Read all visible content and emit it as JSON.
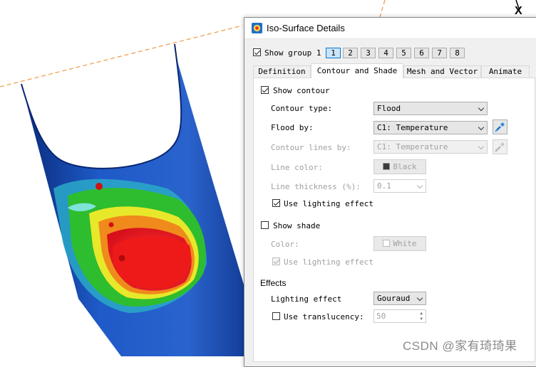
{
  "dialog": {
    "title": "Iso-Surface Details",
    "show_group_label": "Show group 1",
    "group_buttons": [
      "1",
      "2",
      "3",
      "4",
      "5",
      "6",
      "7",
      "8"
    ],
    "active_group": "1",
    "tabs": [
      "Definition",
      "Contour and Shade",
      "Mesh and Vector",
      "Animate"
    ],
    "active_tab": "Contour and Shade",
    "contour": {
      "show_contour_label": "Show contour",
      "show_contour_checked": true,
      "contour_type_label": "Contour type:",
      "contour_type_value": "Flood",
      "flood_by_label": "Flood by:",
      "flood_by_value": "C1: Temperature",
      "contour_lines_by_label": "Contour lines by:",
      "contour_lines_by_value": "C1: Temperature",
      "line_color_label": "Line color:",
      "line_color_value": "Black",
      "line_color_hex": "#3c3c3c",
      "line_thickness_label": "Line thickness (%):",
      "line_thickness_value": "0.1",
      "use_lighting_label": "Use lighting effect",
      "use_lighting_checked": true
    },
    "shade": {
      "show_shade_label": "Show shade",
      "show_shade_checked": false,
      "color_label": "Color:",
      "color_value": "White",
      "color_hex": "#ffffff",
      "use_lighting_label": "Use lighting effect",
      "use_lighting_checked": true
    },
    "effects": {
      "heading": "Effects",
      "lighting_effect_label": "Lighting effect",
      "lighting_effect_value": "Gouraud",
      "use_translucency_label": "Use translucency:",
      "use_translucency_checked": false,
      "translucency_value": "50"
    }
  },
  "viewport": {
    "axis_label": "X",
    "colors": {
      "blue": "#1c4fb0",
      "green": "#2ebd2e",
      "yellow": "#e8e82a",
      "orange": "#f08a1c",
      "red": "#e81c1c",
      "dash_line": "#f0a050"
    }
  },
  "watermark": "CSDN @家有琦琦果"
}
